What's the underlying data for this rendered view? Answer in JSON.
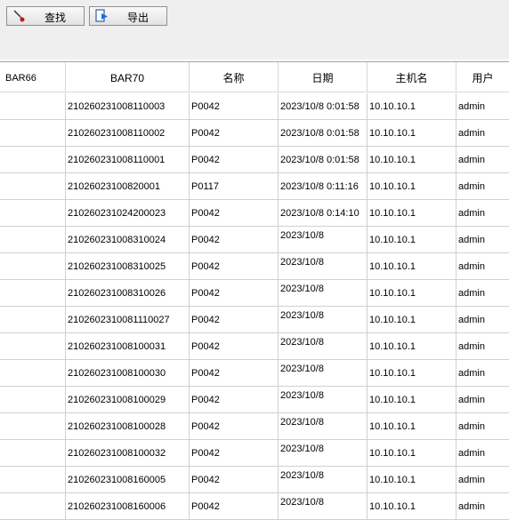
{
  "toolbar": {
    "search_label": "查找",
    "export_label": "导出",
    "search_icon": "search-brush-icon",
    "export_icon": "export-document-icon"
  },
  "columns": [
    "BAR66",
    "BAR70",
    "名称",
    "日期",
    "主机名",
    "用户"
  ],
  "rows": [
    {
      "bar66": "",
      "bar70": "210260231008110003",
      "name": "P0042",
      "date": "2023/10/8 0:01:58",
      "host": "10.10.10.1",
      "user": "admin"
    },
    {
      "bar66": "",
      "bar70": "210260231008110002",
      "name": "P0042",
      "date": "2023/10/8 0:01:58",
      "host": "10.10.10.1",
      "user": "admin"
    },
    {
      "bar66": "",
      "bar70": "210260231008110001",
      "name": "P0042",
      "date": "2023/10/8 0:01:58",
      "host": "10.10.10.1",
      "user": "admin"
    },
    {
      "bar66": "",
      "bar70": "21026023100820001",
      "name": "P0117",
      "date": "2023/10/8 0:11:16",
      "host": "10.10.10.1",
      "user": "admin"
    },
    {
      "bar66": "",
      "bar70": "210260231024200023",
      "name": "P0042",
      "date": "2023/10/8 0:14:10",
      "host": "10.10.10.1",
      "user": "admin"
    },
    {
      "bar66": "",
      "bar70": "210260231008310024",
      "name": "P0042",
      "date": "2023/10/8",
      "host": "10.10.10.1",
      "user": "admin"
    },
    {
      "bar66": "",
      "bar70": "210260231008310025",
      "name": "P0042",
      "date": "2023/10/8",
      "host": "10.10.10.1",
      "user": "admin"
    },
    {
      "bar66": "",
      "bar70": "210260231008310026",
      "name": "P0042",
      "date": "2023/10/8",
      "host": "10.10.10.1",
      "user": "admin"
    },
    {
      "bar66": "",
      "bar70": "2102602310081110027",
      "name": "P0042",
      "date": "2023/10/8",
      "host": "10.10.10.1",
      "user": "admin"
    },
    {
      "bar66": "",
      "bar70": "210260231008100031",
      "name": "P0042",
      "date": "2023/10/8",
      "host": "10.10.10.1",
      "user": "admin"
    },
    {
      "bar66": "",
      "bar70": "210260231008100030",
      "name": "P0042",
      "date": "2023/10/8",
      "host": "10.10.10.1",
      "user": "admin"
    },
    {
      "bar66": "",
      "bar70": "210260231008100029",
      "name": "P0042",
      "date": "2023/10/8",
      "host": "10.10.10.1",
      "user": "admin"
    },
    {
      "bar66": "",
      "bar70": "210260231008100028",
      "name": "P0042",
      "date": "2023/10/8",
      "host": "10.10.10.1",
      "user": "admin"
    },
    {
      "bar66": "",
      "bar70": "210260231008100032",
      "name": "P0042",
      "date": "2023/10/8",
      "host": "10.10.10.1",
      "user": "admin"
    },
    {
      "bar66": "",
      "bar70": "210260231008160005",
      "name": "P0042",
      "date": "2023/10/8",
      "host": "10.10.10.1",
      "user": "admin"
    },
    {
      "bar66": "",
      "bar70": "210260231008160006",
      "name": "P0042",
      "date": "2023/10/8",
      "host": "10.10.10.1",
      "user": "admin"
    }
  ]
}
